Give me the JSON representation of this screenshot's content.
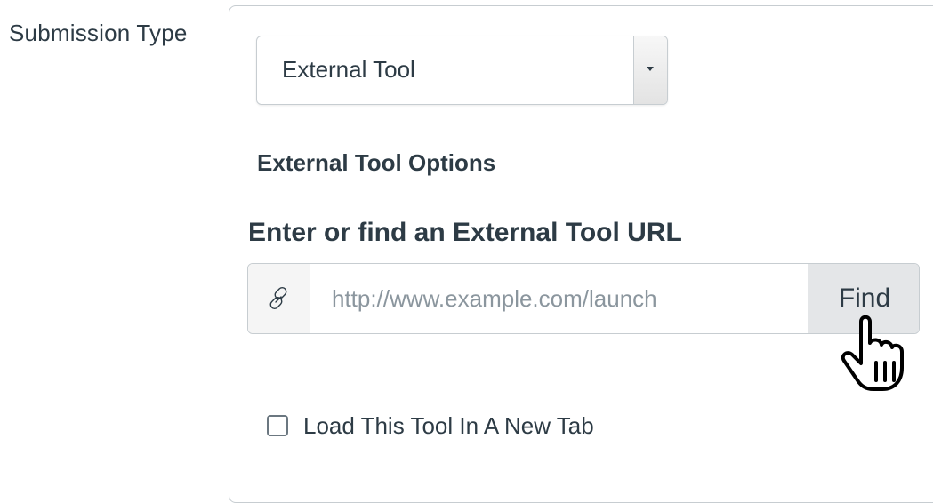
{
  "submission_type": {
    "label": "Submission Type",
    "selected_value": "External Tool"
  },
  "external_tool": {
    "options_heading": "External Tool Options",
    "url_heading": "Enter or find an External Tool URL",
    "url_placeholder": "http://www.example.com/launch",
    "url_value": "",
    "find_label": "Find",
    "new_tab_label": "Load This Tool In A New Tab",
    "new_tab_checked": false
  },
  "icons": {
    "link": "link-icon",
    "dropdown": "caret-down-icon",
    "cursor": "hand-pointer-cursor"
  },
  "colors": {
    "text": "#2d3b45",
    "border": "#c7cdd1",
    "button_bg": "#e4e6e8",
    "placeholder": "#8b969e"
  }
}
